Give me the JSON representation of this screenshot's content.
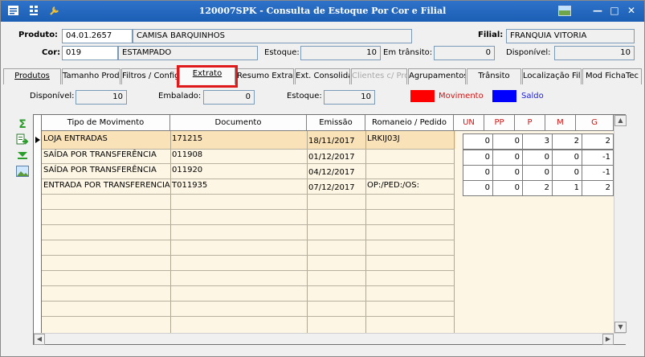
{
  "window": {
    "title": "120007SPK - Consulta de Estoque Por Cor e Filial",
    "icons": [
      "menu-icon",
      "grid-icon",
      "wrench-icon",
      "photo-icon",
      "minimize-icon",
      "maximize-icon",
      "close-icon"
    ],
    "minimize_glyph": "—",
    "maximize_glyph": "□",
    "close_glyph": "✕"
  },
  "header": {
    "produto_label": "Produto:",
    "produto_code": "04.01.2657",
    "produto_desc": "CAMISA BARQUINHOS",
    "filial_label": "Filial:",
    "filial_value": "FRANQUIA VITORIA",
    "cor_label": "Cor:",
    "cor_code": "019",
    "cor_desc": "ESTAMPADO",
    "estoque_label": "Estoque:",
    "estoque_value": "10",
    "em_transito_label": "Em trânsito:",
    "em_transito_value": "0",
    "disponivel_label": "Disponível:",
    "disponivel_value": "10"
  },
  "tabs": [
    {
      "label": "Produtos"
    },
    {
      "label": "Tamanho Produto"
    },
    {
      "label": "Filtros / Configurações"
    },
    {
      "label": "Extrato"
    },
    {
      "label": "Resumo Extrato"
    },
    {
      "label": "Ext. Consolidado"
    },
    {
      "label": "Clientes c/ Produto"
    },
    {
      "label": "Agrupamentos"
    },
    {
      "label": "Trânsito"
    },
    {
      "label": "Localização Filial"
    },
    {
      "label": "Mod FichaTec"
    }
  ],
  "extrato": {
    "disponivel_label": "Disponível:",
    "disponivel_value": "10",
    "embalado_label": "Embalado:",
    "embalado_value": "0",
    "estoque_label": "Estoque:",
    "estoque_value": "10",
    "legend_movimento": "Movimento",
    "legend_saldo": "Saldo",
    "movimento_color": "#ff0000",
    "saldo_color": "#0000ff"
  },
  "grid": {
    "columns": [
      "Tipo de Movimento",
      "Documento",
      "Emissão",
      "Romaneio / Pedido",
      "UN",
      "PP",
      "P",
      "M",
      "G"
    ],
    "rows": [
      {
        "tipo": "LOJA ENTRADAS",
        "documento": "171215",
        "emissao": "18/11/2017",
        "romaneio": "LRKIJ03J",
        "un": "0",
        "pp": "0",
        "p": "3",
        "m": "2",
        "g": "2"
      },
      {
        "tipo": "SAÍDA POR TRANSFERÊNCIA",
        "documento": "011908",
        "emissao": "01/12/2017",
        "romaneio": "",
        "un": "0",
        "pp": "0",
        "p": "0",
        "m": "0",
        "g": "-1"
      },
      {
        "tipo": "SAÍDA POR TRANSFERÊNCIA",
        "documento": "011920",
        "emissao": "04/12/2017",
        "romaneio": "",
        "un": "0",
        "pp": "0",
        "p": "0",
        "m": "0",
        "g": "-1"
      },
      {
        "tipo": "ENTRADA POR TRANSFERENCIA",
        "documento": "T011935",
        "emissao": "07/12/2017",
        "romaneio": "OP:/PED:/OS:",
        "un": "0",
        "pp": "0",
        "p": "2",
        "m": "1",
        "g": "2"
      }
    ]
  },
  "side_icons": [
    "sum-icon",
    "export-icon",
    "collapse-down-icon",
    "image-icon"
  ],
  "sum_glyph": "Σ"
}
